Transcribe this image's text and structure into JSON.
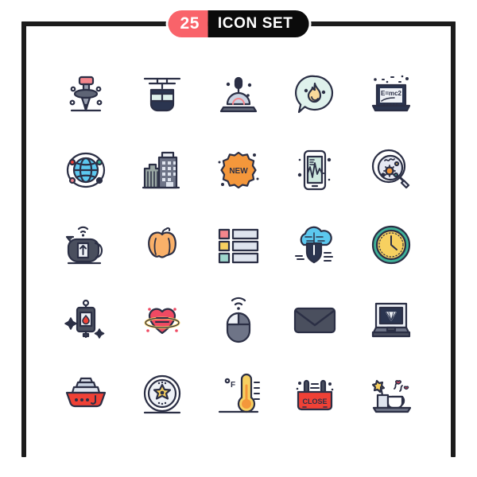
{
  "header": {
    "count": "25",
    "title": "ICON SET"
  },
  "palette": {
    "frame": "#1c1c1c",
    "badge_count_bg": "#f9636a",
    "badge_title_bg": "#0b0b0b",
    "badge_text": "#ffffff",
    "outline": "#2b2f45",
    "salmon": "#f4868c",
    "red": "#ef4136",
    "orange": "#f4973b",
    "pumpkin": "#f9b069",
    "yellow": "#f7d060",
    "mint": "#d8efe6",
    "teal": "#3fb39a",
    "sky": "#61c3ee",
    "lavender": "#dfe3ef",
    "gray": "#6e7487",
    "dark_gray": "#3c4156",
    "white": "#ffffff"
  },
  "grid": {
    "columns": 5,
    "rows": 5,
    "total": 25,
    "icons": [
      {
        "index": 1,
        "row": 1,
        "col": 1,
        "name": "3d-printer-nozzle-icon",
        "label": "3D printer nozzle"
      },
      {
        "index": 2,
        "row": 1,
        "col": 2,
        "name": "cable-car-icon",
        "label": "Cable car"
      },
      {
        "index": 3,
        "row": 1,
        "col": 3,
        "name": "gear-shift-icon",
        "label": "Gear shifter"
      },
      {
        "index": 4,
        "row": 1,
        "col": 4,
        "name": "hot-topic-bubble-icon",
        "label": "Flame speech bubble"
      },
      {
        "index": 5,
        "row": 1,
        "col": 5,
        "name": "physics-laptop-icon",
        "label": "Laptop E=mc2",
        "text": "E=mc2"
      },
      {
        "index": 6,
        "row": 2,
        "col": 1,
        "name": "global-network-icon",
        "label": "Globe network"
      },
      {
        "index": 7,
        "row": 2,
        "col": 2,
        "name": "office-buildings-icon",
        "label": "Office buildings"
      },
      {
        "index": 8,
        "row": 2,
        "col": 3,
        "name": "new-badge-icon",
        "label": "New badge",
        "text": "NEW"
      },
      {
        "index": 9,
        "row": 2,
        "col": 4,
        "name": "mobile-pulse-icon",
        "label": "Mobile heartbeat"
      },
      {
        "index": 10,
        "row": 2,
        "col": 5,
        "name": "virus-search-icon",
        "label": "Magnifier virus"
      },
      {
        "index": 11,
        "row": 3,
        "col": 1,
        "name": "smart-kettle-icon",
        "label": "Smart kettle"
      },
      {
        "index": 12,
        "row": 3,
        "col": 2,
        "name": "pumpkin-icon",
        "label": "Pumpkin"
      },
      {
        "index": 13,
        "row": 3,
        "col": 3,
        "name": "list-layout-icon",
        "label": "List layout"
      },
      {
        "index": 14,
        "row": 3,
        "col": 4,
        "name": "cloud-security-icon",
        "label": "Cloud shield"
      },
      {
        "index": 15,
        "row": 3,
        "col": 5,
        "name": "wall-clock-icon",
        "label": "Clock"
      },
      {
        "index": 16,
        "row": 4,
        "col": 1,
        "name": "blood-bag-icon",
        "label": "Blood bag drip"
      },
      {
        "index": 17,
        "row": 4,
        "col": 2,
        "name": "heart-orbit-icon",
        "label": "Heart with ring"
      },
      {
        "index": 18,
        "row": 4,
        "col": 3,
        "name": "wireless-mouse-icon",
        "label": "Wireless mouse"
      },
      {
        "index": 19,
        "row": 4,
        "col": 4,
        "name": "envelope-icon",
        "label": "Envelope"
      },
      {
        "index": 20,
        "row": 4,
        "col": 5,
        "name": "diamond-laptop-icon",
        "label": "Laptop diamond"
      },
      {
        "index": 21,
        "row": 5,
        "col": 1,
        "name": "ship-icon",
        "label": "Ship"
      },
      {
        "index": 22,
        "row": 5,
        "col": 2,
        "name": "sheriff-star-icon",
        "label": "Star badge wheel"
      },
      {
        "index": 23,
        "row": 5,
        "col": 3,
        "name": "fahrenheit-thermometer-icon",
        "label": "Fahrenheit thermometer",
        "text": "F"
      },
      {
        "index": 24,
        "row": 5,
        "col": 4,
        "name": "close-sign-icon",
        "label": "Close sign",
        "text": "CLOSE"
      },
      {
        "index": 25,
        "row": 5,
        "col": 5,
        "name": "coffee-gift-icon",
        "label": "Coffee and gift"
      }
    ]
  }
}
